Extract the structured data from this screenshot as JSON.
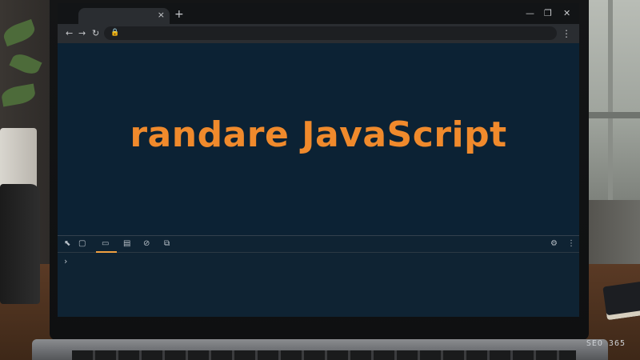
{
  "page": {
    "headline": "randare JavaScript"
  },
  "browser": {
    "tab_close_glyph": "×",
    "new_tab_glyph": "+",
    "window_controls": [
      "—",
      "❐",
      "✕"
    ],
    "nav": {
      "back": "←",
      "forward": "→",
      "reload": "↻"
    },
    "lock_glyph": "🔒",
    "menu_glyph": "⋮"
  },
  "devtools": {
    "toolbar_icons": [
      "⬉",
      "▢",
      "▭",
      "▤",
      "⊘",
      "⧉"
    ],
    "settings_glyph": "⚙",
    "menu_glyph": "⋮",
    "console_prompt": "›"
  },
  "overlay": {
    "watermark": "SEO 365"
  },
  "colors": {
    "headline": "#f08a2c",
    "page_background": "#0c2234",
    "devtools_active": "#f0a040"
  }
}
